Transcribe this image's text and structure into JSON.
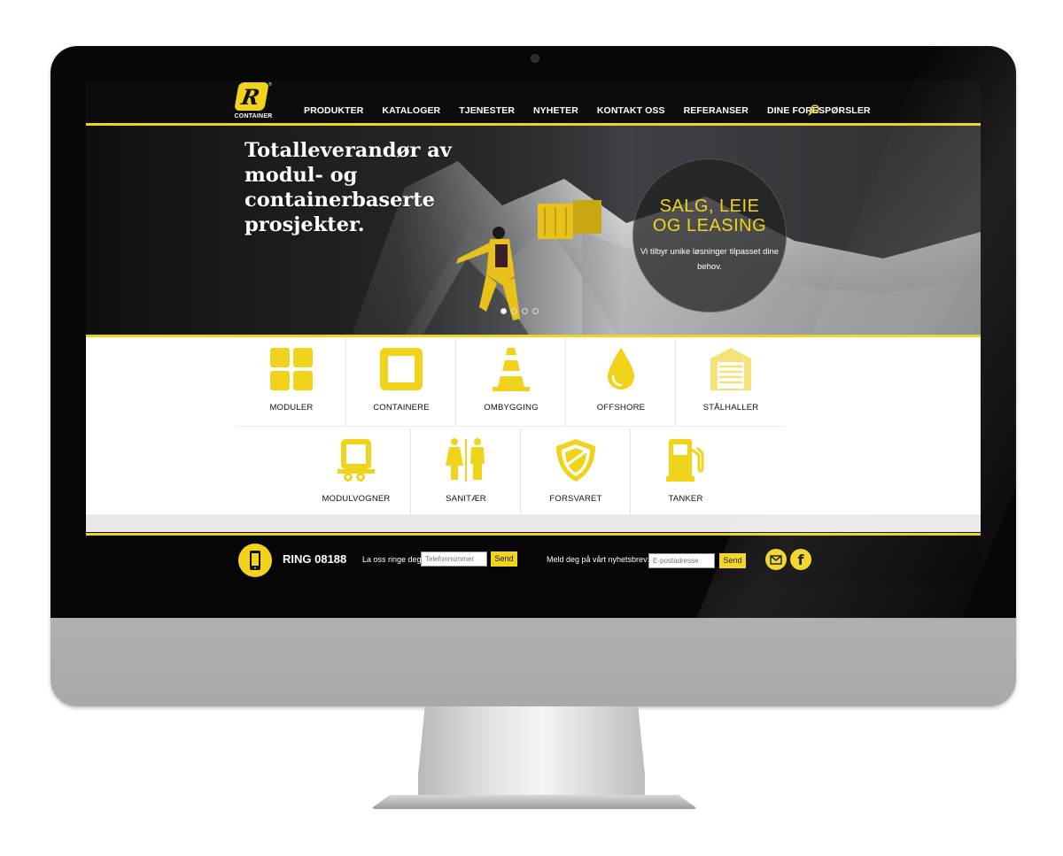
{
  "brand": {
    "logo_text": "CONTAINER",
    "logo_letter": "R",
    "accent": "#f1d31c",
    "dark": "#0c0c0c"
  },
  "nav": {
    "items": [
      "PRODUKTER",
      "KATALOGER",
      "TJENESTER",
      "NYHETER",
      "KONTAKT OSS",
      "REFERANSER",
      "DINE FORESPØRSLER"
    ],
    "search_icon": "search-icon"
  },
  "hero": {
    "headline": "Totalleverandør av modul- og containerbaserte prosjekter.",
    "circle_title_line1": "SALG, LEIE",
    "circle_title_line2": "OG LEASING",
    "circle_text": "Vi tilbyr unike løsninger tilpasset dine behov.",
    "slides": 4,
    "active_slide": 1
  },
  "categories": {
    "row1": [
      {
        "label": "MODULER",
        "icon": "grid-icon"
      },
      {
        "label": "CONTAINERE",
        "icon": "square-icon"
      },
      {
        "label": "OMBYGGING",
        "icon": "traffic-cone-icon"
      },
      {
        "label": "OFFSHORE",
        "icon": "oil-drop-icon"
      },
      {
        "label": "STÅLHALLER",
        "icon": "garage-icon"
      }
    ],
    "row2": [
      {
        "label": "MODULVOGNER",
        "icon": "trailer-icon"
      },
      {
        "label": "SANITÆR",
        "icon": "restroom-icon"
      },
      {
        "label": "FORSVARET",
        "icon": "shield-icon"
      },
      {
        "label": "TANKER",
        "icon": "fuel-pump-icon"
      }
    ]
  },
  "footer": {
    "ring": "RING 08188",
    "call_label": "La oss ringe deg:",
    "phone_placeholder": "Telefonnummer",
    "send1": "Send",
    "news_label": "Meld deg på vårt nyhetsbrev:",
    "email_placeholder": "E-postadresse",
    "send2": "Send",
    "facebook_glyph": "f"
  }
}
